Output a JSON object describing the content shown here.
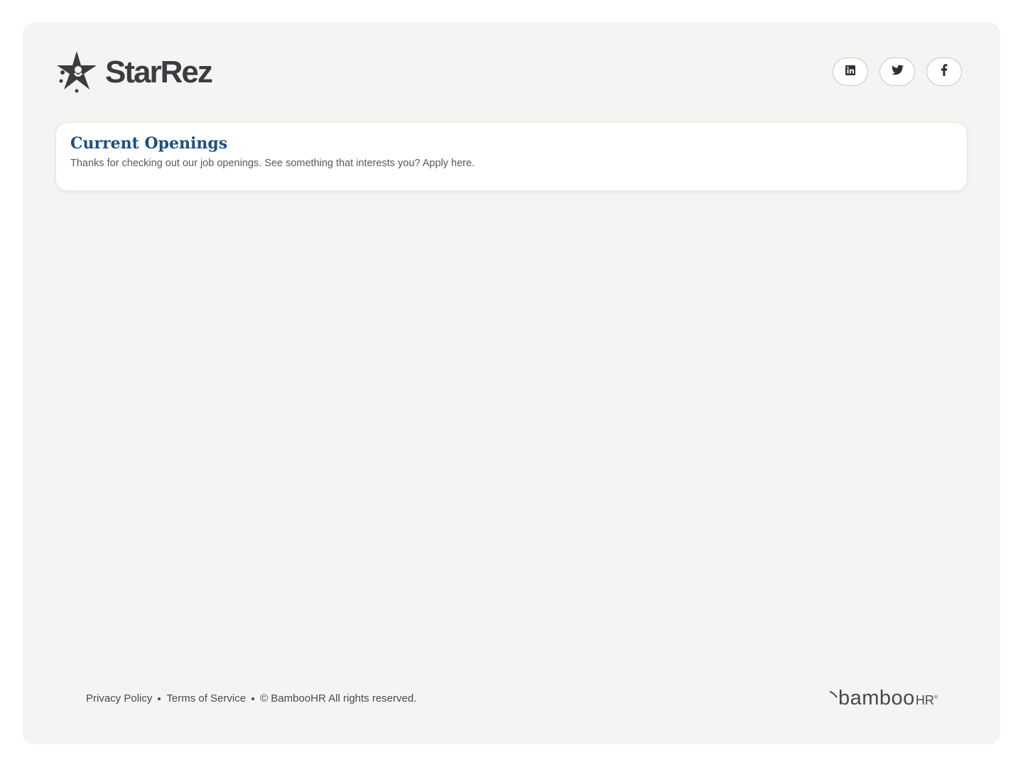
{
  "company": {
    "name": "StarRez",
    "logo_icon": "starrez-star-icon"
  },
  "socials": [
    {
      "name": "LinkedIn",
      "icon": "linkedin-icon"
    },
    {
      "name": "Twitter",
      "icon": "twitter-icon"
    },
    {
      "name": "Facebook",
      "icon": "facebook-icon"
    }
  ],
  "openings": {
    "title": "Current Openings",
    "subtitle": "Thanks for checking out our job openings. See something that interests you? Apply here."
  },
  "footer": {
    "privacy_label": "Privacy Policy",
    "terms_label": "Terms of Service",
    "copyright": "© BambooHR All rights reserved.",
    "brand_main": "bamboo",
    "brand_hr": "HR",
    "brand_reg": "®"
  },
  "colors": {
    "page_bg": "#f5f4f2",
    "title": "#1d4f7c",
    "text": "#48494b",
    "logo": "#3a3d40"
  }
}
